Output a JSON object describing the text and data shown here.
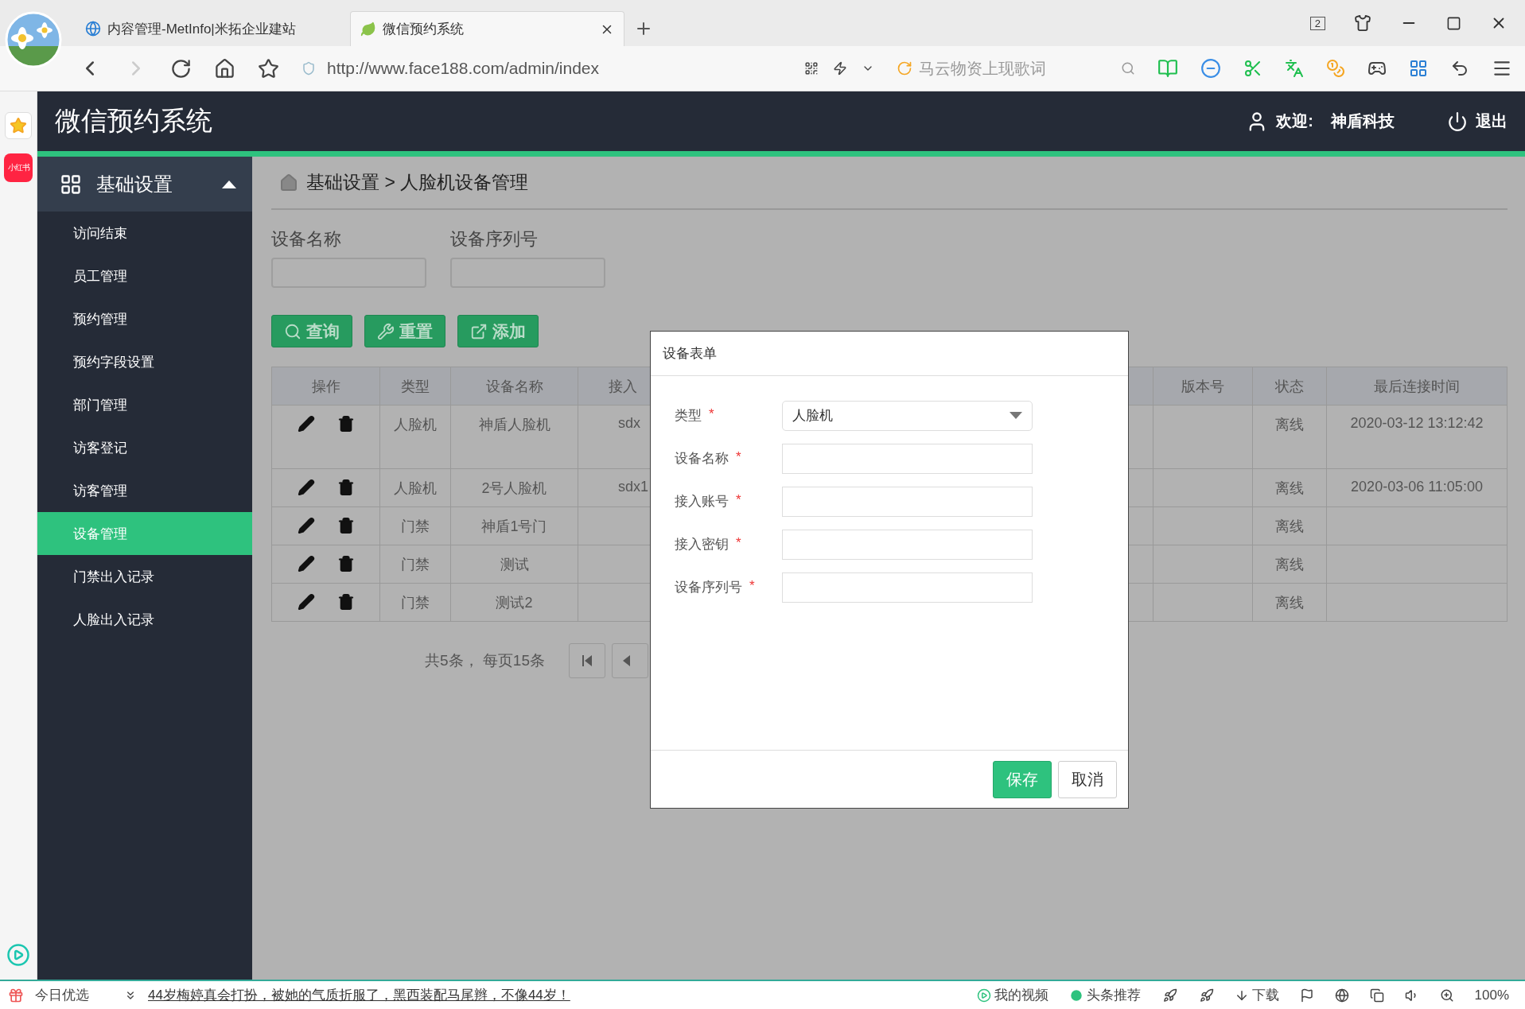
{
  "browser": {
    "tabs": [
      {
        "title": "内容管理-MetInfo|米拓企业建站",
        "selected": false
      },
      {
        "title": "微信预约系统",
        "selected": true
      }
    ],
    "window_count": "2",
    "address": "http://www.face188.com/admin/index",
    "search_placeholder": "马云物资上现歌词"
  },
  "side_strip": {
    "app_badge": "小红书"
  },
  "app": {
    "title": "微信预约系统",
    "welcome": "欢迎:",
    "user": "神盾科技",
    "logout": "退出"
  },
  "sidebar": {
    "section": {
      "label": "基础设置",
      "expanded": true
    },
    "items": [
      {
        "label": "访问结束",
        "selected": false
      },
      {
        "label": "员工管理",
        "selected": false
      },
      {
        "label": "预约管理",
        "selected": false
      },
      {
        "label": "预约字段设置",
        "selected": false
      },
      {
        "label": "部门管理",
        "selected": false
      },
      {
        "label": "访客登记",
        "selected": false
      },
      {
        "label": "访客管理",
        "selected": false
      },
      {
        "label": "设备管理",
        "selected": true
      },
      {
        "label": "门禁出入记录",
        "selected": false
      },
      {
        "label": "人脸出入记录",
        "selected": false
      }
    ]
  },
  "breadcrumb": "基础设置 > 人脸机设备管理",
  "filters": [
    {
      "label": "设备名称"
    },
    {
      "label": "设备序列号"
    }
  ],
  "actions": [
    {
      "label": "查询",
      "kind": "search"
    },
    {
      "label": "重置",
      "kind": "reset"
    },
    {
      "label": "添加",
      "kind": "add"
    }
  ],
  "table": {
    "columns": [
      {
        "label": "操作"
      },
      {
        "label": "类型"
      },
      {
        "label": "设备名称"
      },
      {
        "label": "接入"
      },
      {},
      {
        "label": "版本号"
      },
      {
        "label": "状态"
      },
      {
        "label": "最后连接时间"
      }
    ],
    "rows": [
      {
        "type": "人脸机",
        "name": "神盾人脸机",
        "account": "sdx",
        "status": "离线",
        "last_connect": "2020-03-12 13:12:42"
      },
      {
        "type": "人脸机",
        "name": "2号人脸机",
        "account": "sdx1",
        "status": "离线",
        "last_connect": "2020-03-06 11:05:00"
      },
      {
        "type": "门禁",
        "name": "神盾1号门",
        "status": "离线"
      },
      {
        "type": "门禁",
        "name": "测试",
        "status": "离线"
      },
      {
        "type": "门禁",
        "name": "测试2",
        "status": "离线"
      }
    ]
  },
  "pagination": {
    "summary": "共5条， 每页15条"
  },
  "modal": {
    "title": "设备表单",
    "required_mark": "*",
    "fields": [
      {
        "label": "类型",
        "kind": "select",
        "value": "人脸机",
        "required": true
      },
      {
        "label": "设备名称",
        "kind": "text",
        "required": true
      },
      {
        "label": "接入账号",
        "kind": "text",
        "required": true
      },
      {
        "label": "接入密钥",
        "kind": "text",
        "required": true
      },
      {
        "label": "设备序列号",
        "kind": "text",
        "required": true
      }
    ],
    "buttons": [
      {
        "label": "保存",
        "kind": "primary"
      },
      {
        "label": "取消",
        "kind": "default"
      }
    ]
  },
  "status_bar": {
    "label": "今日优选",
    "headline": "44岁梅婷真会打扮，被她的气质折服了，黑西装配马尾辫，不像44岁！",
    "items": [
      {
        "label": "我的视频",
        "kind": "video"
      },
      {
        "label": "头条推荐",
        "kind": "news"
      },
      {
        "label": "下载",
        "kind": "download"
      }
    ],
    "zoom": "100%"
  }
}
